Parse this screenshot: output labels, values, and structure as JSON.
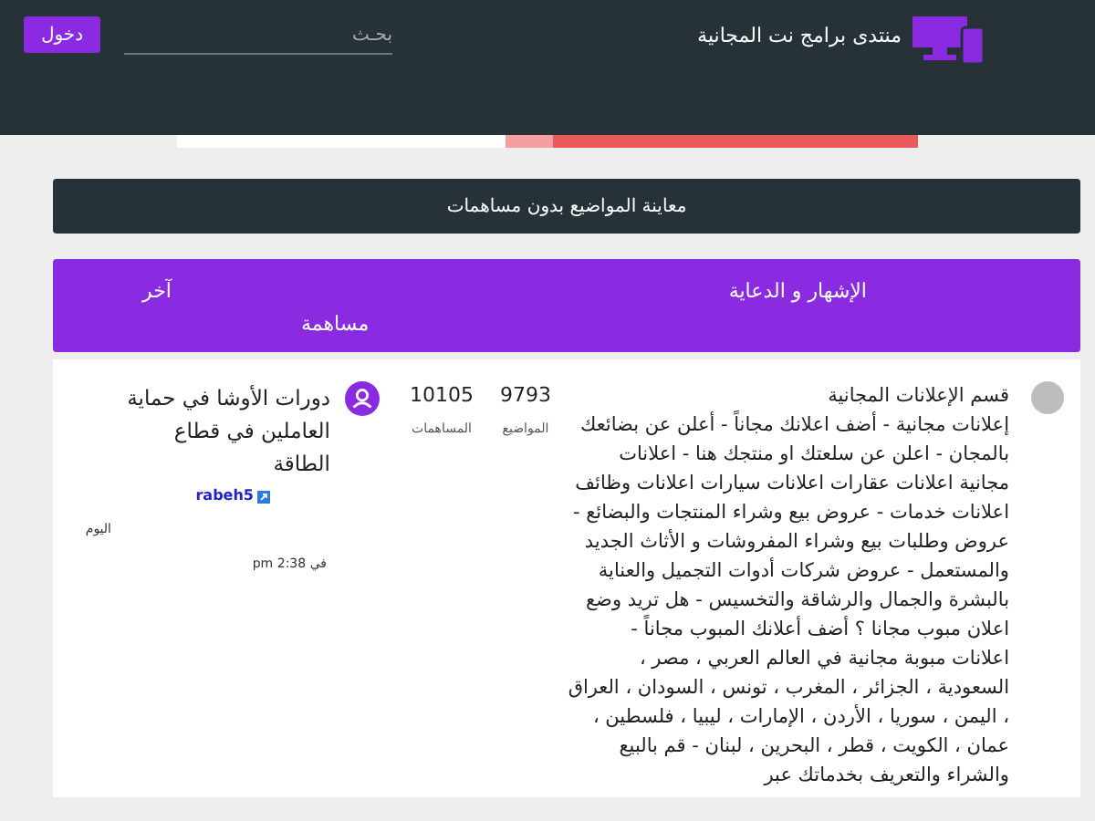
{
  "header": {
    "site_title": "منتدى برامج نت المجانية",
    "search": {
      "placeholder": "بحـث"
    },
    "login_button": "دخول"
  },
  "notice_bar": "معاينة المواضيع بدون مساهمات",
  "category": {
    "title": "الإشهار و الدعاية",
    "last_post_heading": [
      "آخر",
      "مساهمة"
    ]
  },
  "forums": [
    {
      "unread": false,
      "title": "قسم الإعلانات المجانية",
      "description": "إعلانات مجانية - أضف اعلانك مجاناً - أعلن عن بضائعك بالمجان - اعلن عن سلعتك او منتجك هنا - اعلانات مجانية اعلانات عقارات اعلانات سيارات اعلانات وظائف اعلانات خدمات - عروض بيع وشراء المنتجات والبضائع - عروض وطلبات بيع وشراء المفروشات و الأثاث الجديد والمستعمل - عروض شركات أدوات التجميل والعناية بالبشرة والجمال والرشاقة والتخسيس - هل تريد وضع اعلان مبوب مجانا ؟ أضف أعلانك المبوب مجاناً - اعلانات مبوبة مجانية في العالم العربي ، مصر ، السعودية ، الجزائر ، المغرب ، تونس ، السودان ، العراق ، اليمن ، سوريا ، الأردن ، الإمارات ، ليبيا ، فلسطين ، عمان ، الكويت ، قطر ، البحرين ، لبنان - قم بالبيع والشراء والتعريف بخدماتك عبر",
      "topics": "9793",
      "topics_label": "المواضيع",
      "posts": "10105",
      "posts_label": "المساهمات",
      "last_post": {
        "title": "دورات الأوشا في حماية العاملين في قطاع الطاقة",
        "author": "rabeh5",
        "day": "اليوم",
        "time": "في 2:38 pm"
      }
    }
  ]
}
